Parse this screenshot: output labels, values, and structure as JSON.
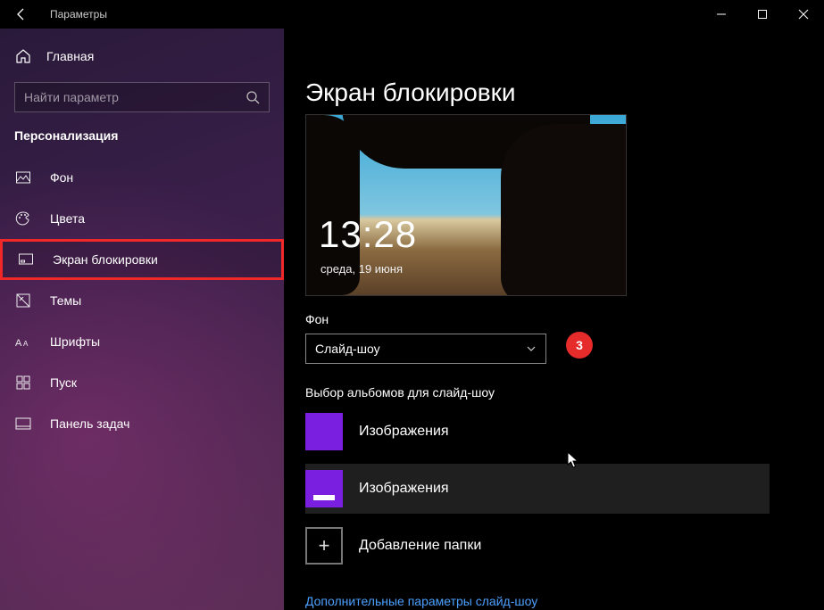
{
  "titlebar": {
    "title": "Параметры"
  },
  "sidebar": {
    "home": "Главная",
    "search_placeholder": "Найти параметр",
    "section": "Персонализация",
    "items": [
      {
        "label": "Фон"
      },
      {
        "label": "Цвета"
      },
      {
        "label": "Экран блокировки"
      },
      {
        "label": "Темы"
      },
      {
        "label": "Шрифты"
      },
      {
        "label": "Пуск"
      },
      {
        "label": "Панель задач"
      }
    ]
  },
  "main": {
    "title": "Экран блокировки",
    "time": "13:28",
    "date": "среда, 19 июня",
    "bg_label": "Фон",
    "bg_value": "Слайд-шоу",
    "badge": "3",
    "albums_label": "Выбор альбомов для слайд-шоу",
    "albums": [
      {
        "label": "Изображения"
      },
      {
        "label": "Изображения"
      }
    ],
    "add_folder": "Добавление папки",
    "advanced_link": "Дополнительные параметры слайд-шоу"
  }
}
